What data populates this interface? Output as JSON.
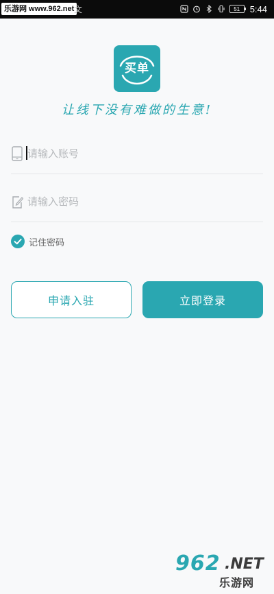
{
  "status_bar": {
    "watermark_text": "乐游网 www.962.net",
    "extra_glyph": "文",
    "icons": [
      "nfc-icon",
      "alarm-icon",
      "bluetooth-icon",
      "vibrate-icon",
      "battery-icon"
    ],
    "battery_level": "51",
    "time": "5:44"
  },
  "app": {
    "logo_text": "买单",
    "slogan": "让线下没有难做的生意!",
    "accent_color": "#2aa7b1"
  },
  "login_form": {
    "account_placeholder": "请输入账号",
    "password_placeholder": "请输入密码",
    "remember_label": "记住密码",
    "remember_checked": true
  },
  "actions": {
    "apply_label": "申请入驻",
    "login_label": "立即登录"
  },
  "watermark": {
    "number": "962",
    "suffix": ".NET",
    "site_name": "乐游网"
  }
}
